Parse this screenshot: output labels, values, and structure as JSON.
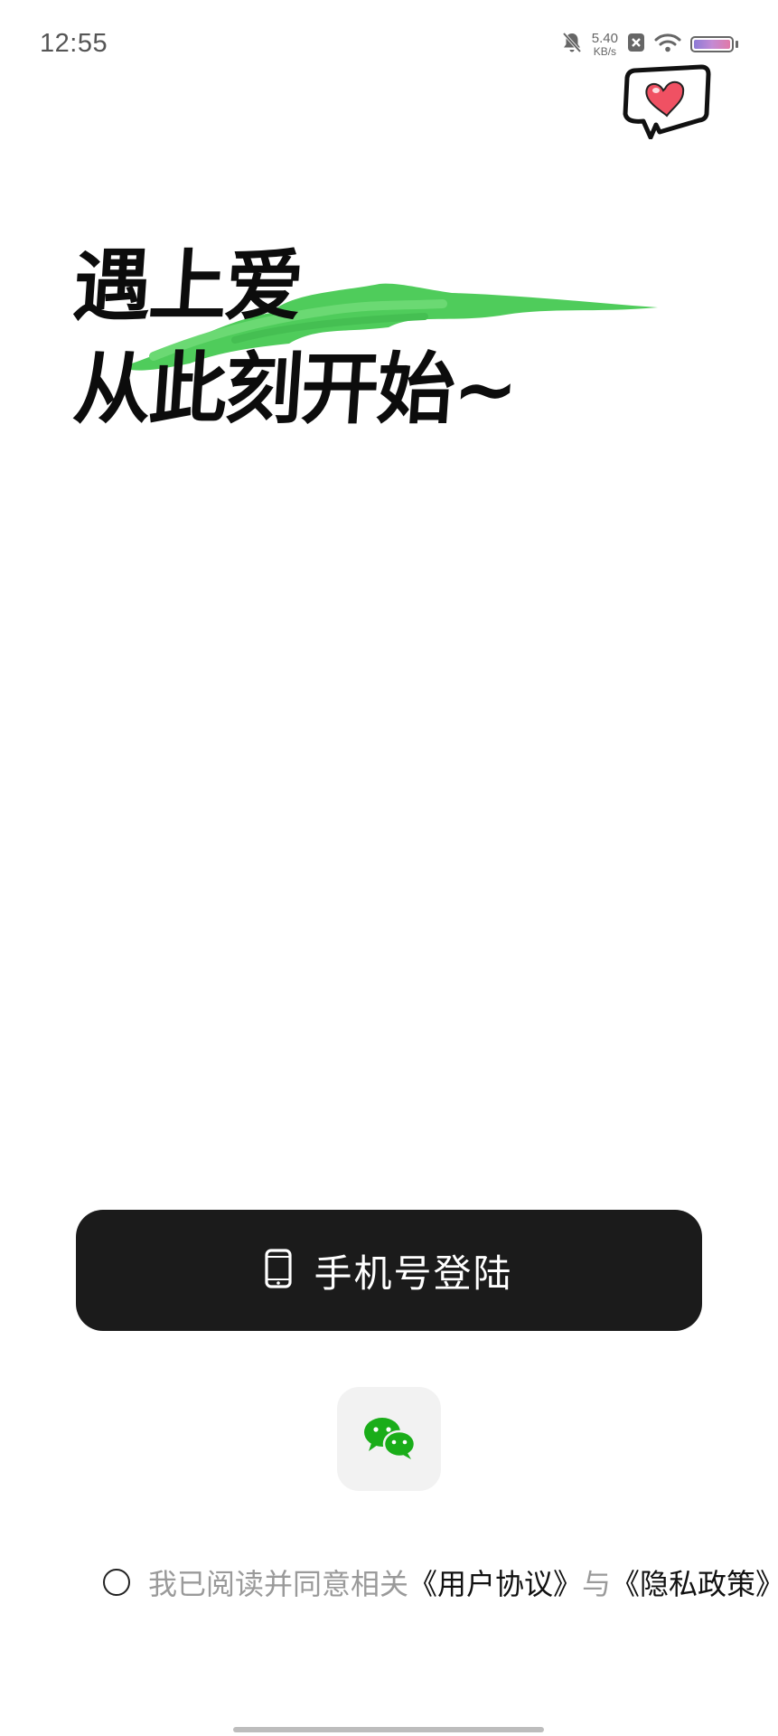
{
  "status_bar": {
    "time": "12:55",
    "net_speed_value": "5.40",
    "net_speed_unit": "KB/s",
    "icons": [
      "bell-muted-icon",
      "sim-off-icon",
      "wifi-icon",
      "battery-icon"
    ]
  },
  "hero": {
    "line1": "遇上爱",
    "line2": "从此刻开始~",
    "brush_color": "#4fcc5b"
  },
  "actions": {
    "phone_login_label": "手机号登陆",
    "phone_icon": "phone-icon",
    "wechat_icon": "wechat-icon"
  },
  "agreement": {
    "prefix": "我已阅读并同意相关",
    "user_agreement": "《用户协议》",
    "conjunction": "与",
    "privacy_policy": "《隐私政策》"
  },
  "colors": {
    "button_bg": "#1b1b1b",
    "wechat_green": "#1aad19",
    "muted_text": "#9a9a9a"
  }
}
